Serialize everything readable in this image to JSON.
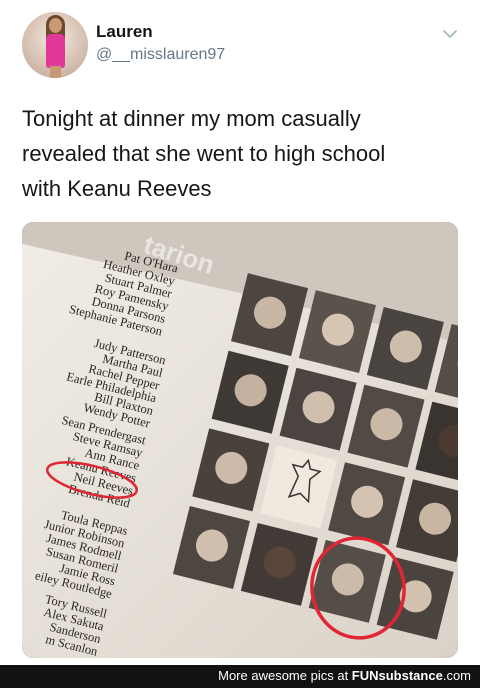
{
  "tweet": {
    "author_name": "Lauren",
    "author_handle": "@__misslauren97",
    "text_lines": [
      "Tonight at dinner my mom casually",
      "revealed that she went to high school",
      "with Keanu Reeves"
    ],
    "menu_icon": "chevron-down-icon"
  },
  "photo": {
    "subject": "yearbook-page",
    "banner_text": "tarion",
    "names_block1": [
      "Pat O'Hara",
      "Heather Oxley",
      "Stuart Palmer",
      "Roy Pamensky",
      "Donna Parsons",
      "Stephanie Paterson"
    ],
    "names_block2": [
      "Judy Patterson",
      "Martha Paul",
      "Rachel Pepper",
      "Earle Philadelphia",
      "Bill Plaxton",
      "Wendy Potter"
    ],
    "names_block3": [
      "Sean Prendergast",
      "Steve Ramsay",
      "Ann Rance",
      "Keanu Reeves",
      "Neil Reeves",
      "Brenda Reid"
    ],
    "names_block4": [
      "Toula Reppas",
      "Junior Robinson",
      "James Rodmell",
      "Susan Romeril",
      "Jamie Ross",
      "eiley Routledge"
    ],
    "names_block5": [
      "Tory Russell",
      "Alex Sakuta",
      "Sanderson",
      "m Scanlon"
    ],
    "highlight_color": "#e02632"
  },
  "footer": {
    "text": "More awesome pics at ",
    "brand": "FUNsubstance",
    "suffix": ".com"
  }
}
